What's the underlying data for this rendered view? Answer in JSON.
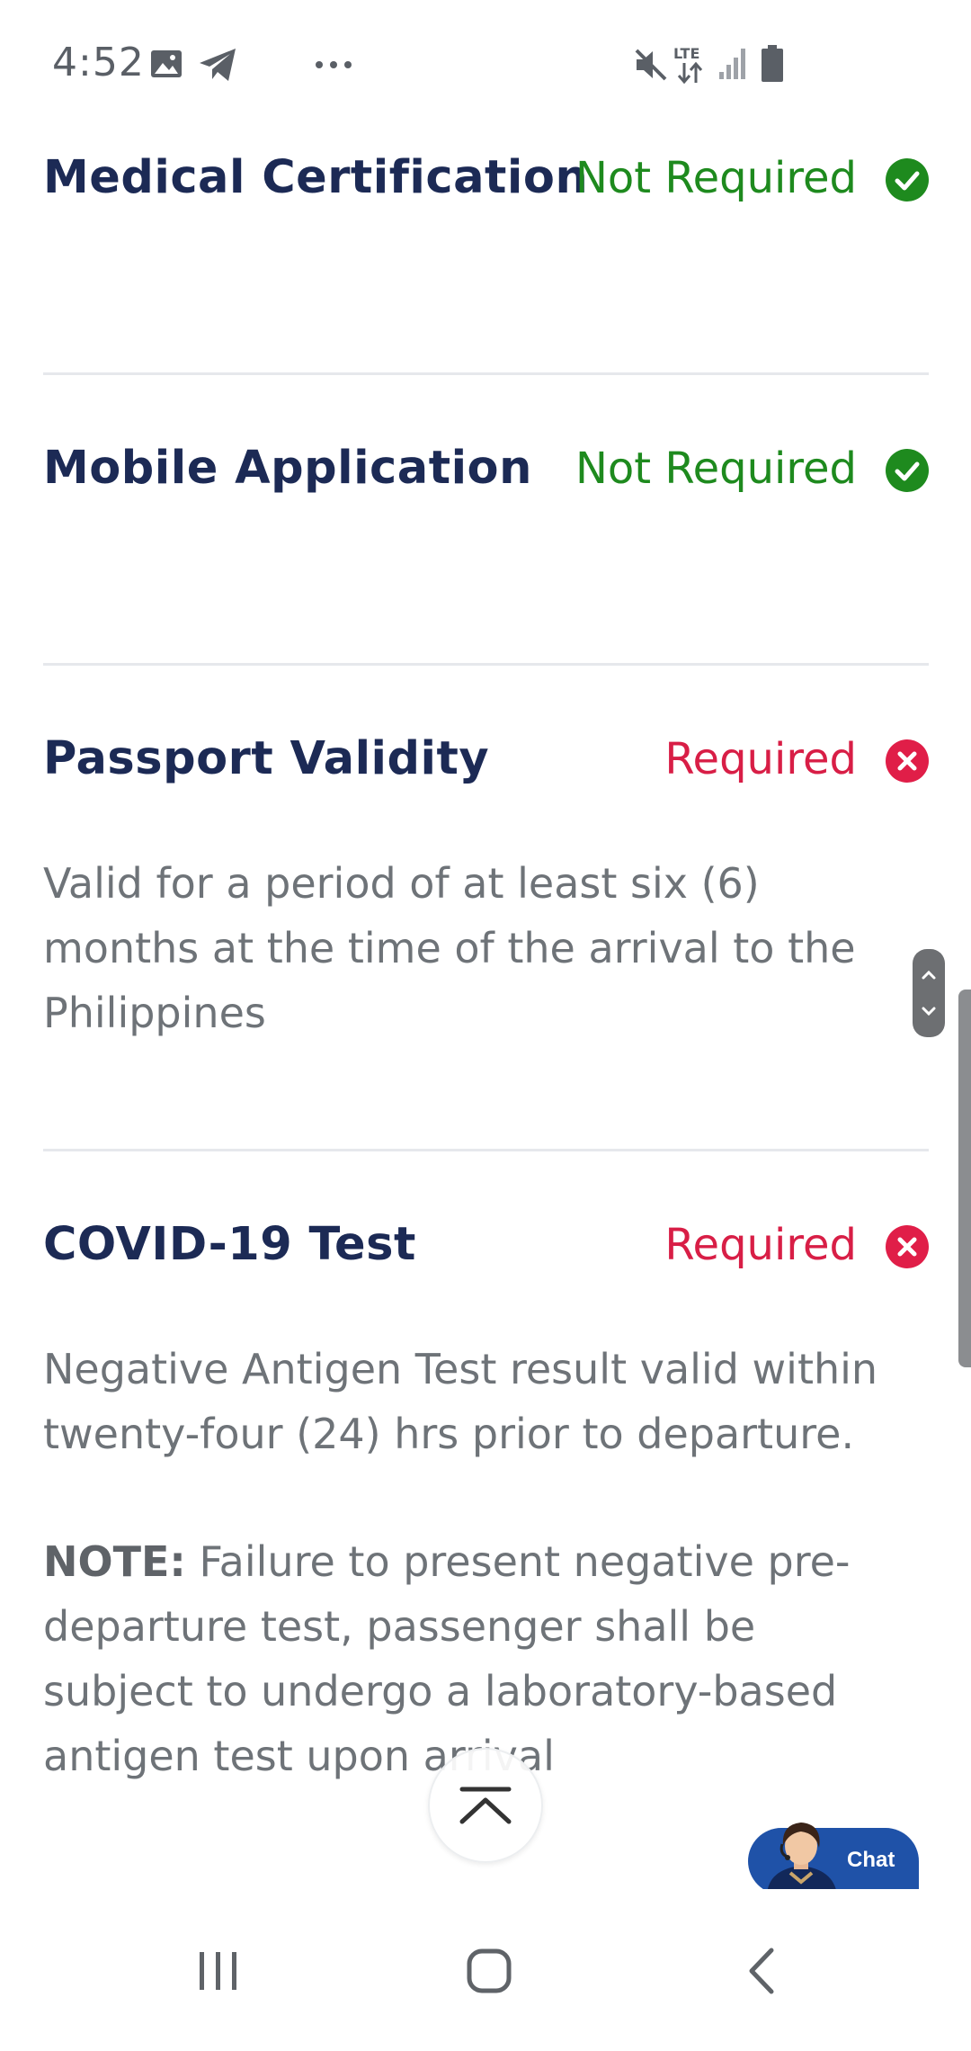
{
  "status_bar": {
    "time": "4:52",
    "network_label": "LTE",
    "left_icons": [
      "image-icon",
      "telegram-icon",
      "more-icon"
    ],
    "right_icons": [
      "mute-icon",
      "lte-icon",
      "signal-icon",
      "battery-icon"
    ]
  },
  "requirements": [
    {
      "title": "Medical Certification",
      "status": "Not Required",
      "status_kind": "ok",
      "icon": "check-circle-icon"
    },
    {
      "title": "Mobile Application",
      "status": "Not Required",
      "status_kind": "ok",
      "icon": "check-circle-icon"
    },
    {
      "title": "Passport Validity",
      "status": "Required",
      "status_kind": "required",
      "icon": "x-circle-icon",
      "description": "Valid for a period of at least six (6) months at the time of the arrival to the Philippines"
    },
    {
      "title": "COVID-19 Test",
      "status": "Required",
      "status_kind": "required",
      "icon": "x-circle-icon",
      "description": "Negative Antigen Test result valid within twenty-four (24) hrs prior to departure.",
      "note_label": "NOTE:",
      "note_text": "Failure to present negative pre-departure test, passenger shall be subject to undergo a laboratory-based antigen test upon arrival"
    }
  ],
  "chat": {
    "label": "Chat"
  },
  "colors": {
    "title": "#1c2a55",
    "not_required": "#1e8a1e",
    "required": "#d81e46",
    "body_text": "#6e7378",
    "chat": "#1f52a8"
  }
}
